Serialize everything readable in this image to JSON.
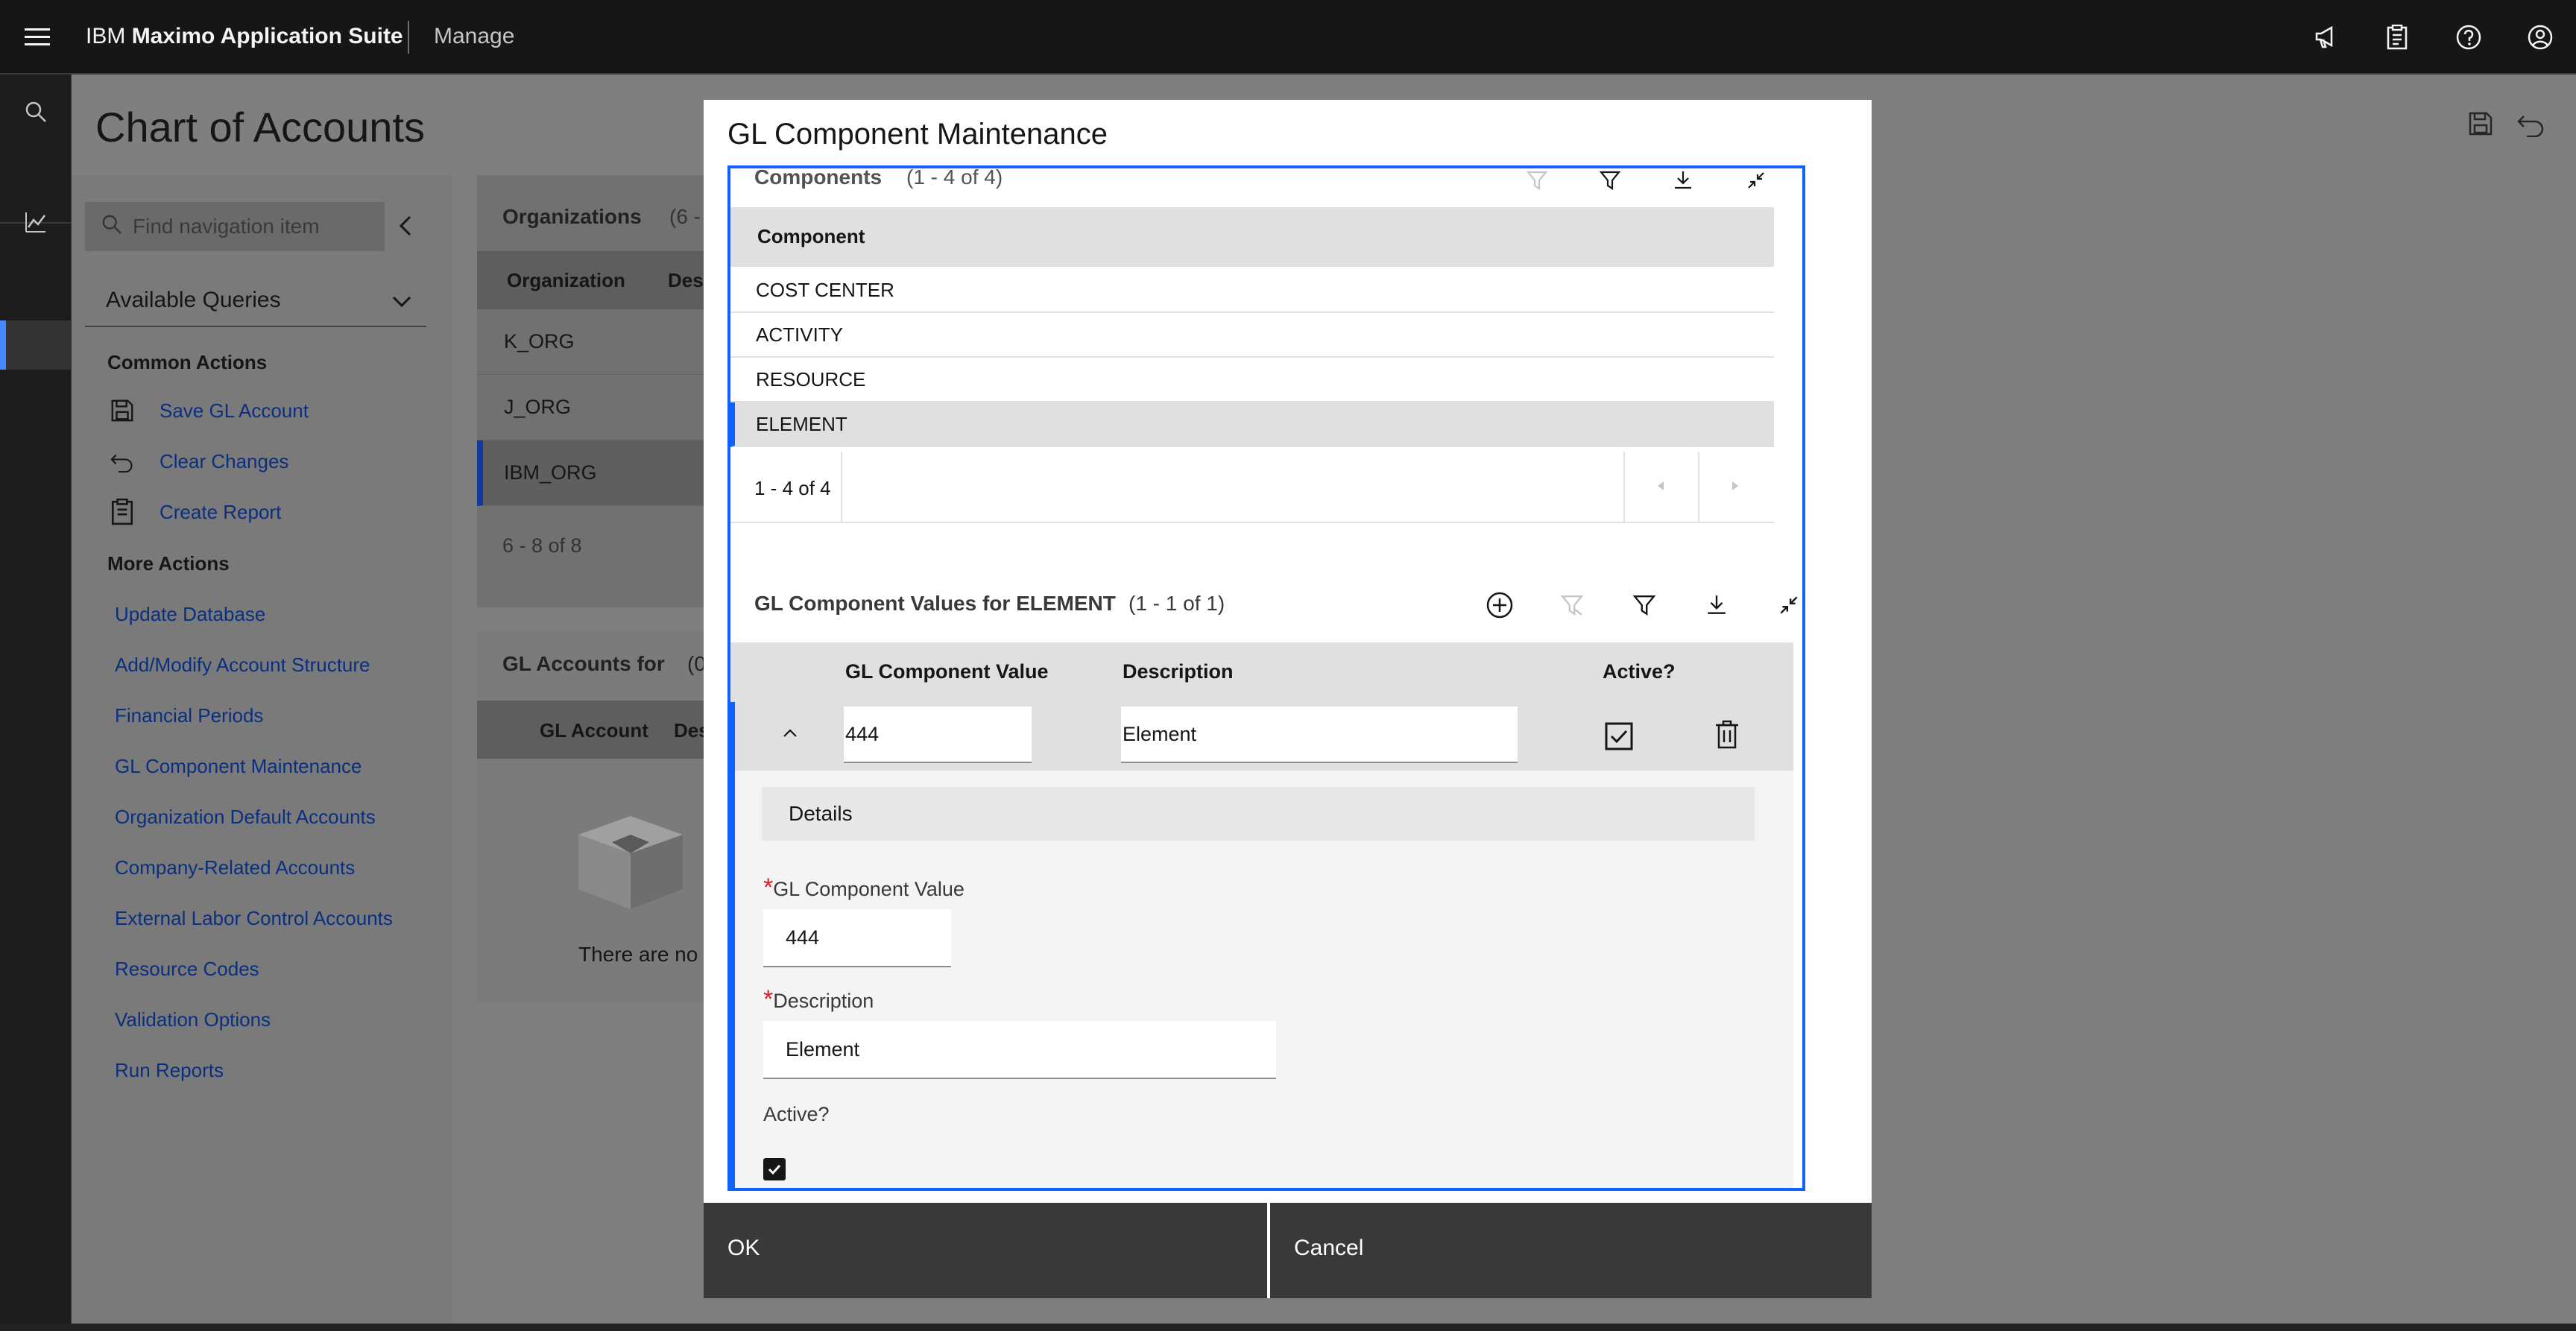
{
  "topbar": {
    "brand_prefix": "IBM",
    "brand_name": "Maximo Application Suite",
    "app_name": "Manage",
    "icons": [
      "megaphone-icon",
      "clipboard-icon",
      "help-icon",
      "user-icon"
    ]
  },
  "page": {
    "title": "Chart of Accounts"
  },
  "nav": {
    "search_placeholder": "Find navigation item",
    "queries_label": "Available Queries",
    "common_actions_header": "Common Actions",
    "common_actions": [
      {
        "label": "Save GL Account",
        "icon": "save-icon"
      },
      {
        "label": "Clear Changes",
        "icon": "undo-icon"
      },
      {
        "label": "Create Report",
        "icon": "report-icon"
      }
    ],
    "more_actions_header": "More Actions",
    "more_actions": [
      "Update Database",
      "Add/Modify Account Structure",
      "Financial Periods",
      "GL Component Maintenance",
      "Organization Default Accounts",
      "Company-Related Accounts",
      "External Labor Control Accounts",
      "Resource Codes",
      "Validation Options",
      "Run Reports"
    ]
  },
  "organizations": {
    "title": "Organizations",
    "count": "(6 -",
    "col_org": "Organization",
    "col_desc": "Des",
    "rows": [
      "K_ORG",
      "J_ORG",
      "IBM_ORG"
    ],
    "pager": "6 - 8 of 8"
  },
  "gl_accounts": {
    "title": "GL Accounts for",
    "count": "(0",
    "col_account": "GL Account",
    "col_desc": "Des",
    "empty_text": "There are no"
  },
  "modal": {
    "title": "GL Component Maintenance",
    "components": {
      "title": "Components",
      "count": "(1 - 4 of 4)",
      "header": "Component",
      "rows": [
        "COST CENTER",
        "ACTIVITY",
        "RESOURCE",
        "ELEMENT"
      ],
      "pager": "1 - 4 of 4"
    },
    "values": {
      "title": "GL Component Values for ELEMENT",
      "count": "(1 - 1 of 1)",
      "col_value": "GL Component Value",
      "col_desc": "Description",
      "col_active": "Active?",
      "row_value": "444",
      "row_desc": "Element",
      "details_title": "Details",
      "detail_value_label": "GL Component Value",
      "detail_value": "444",
      "detail_desc_label": "Description",
      "detail_desc": "Element",
      "detail_active_label": "Active?"
    },
    "ok_label": "OK",
    "cancel_label": "Cancel"
  }
}
